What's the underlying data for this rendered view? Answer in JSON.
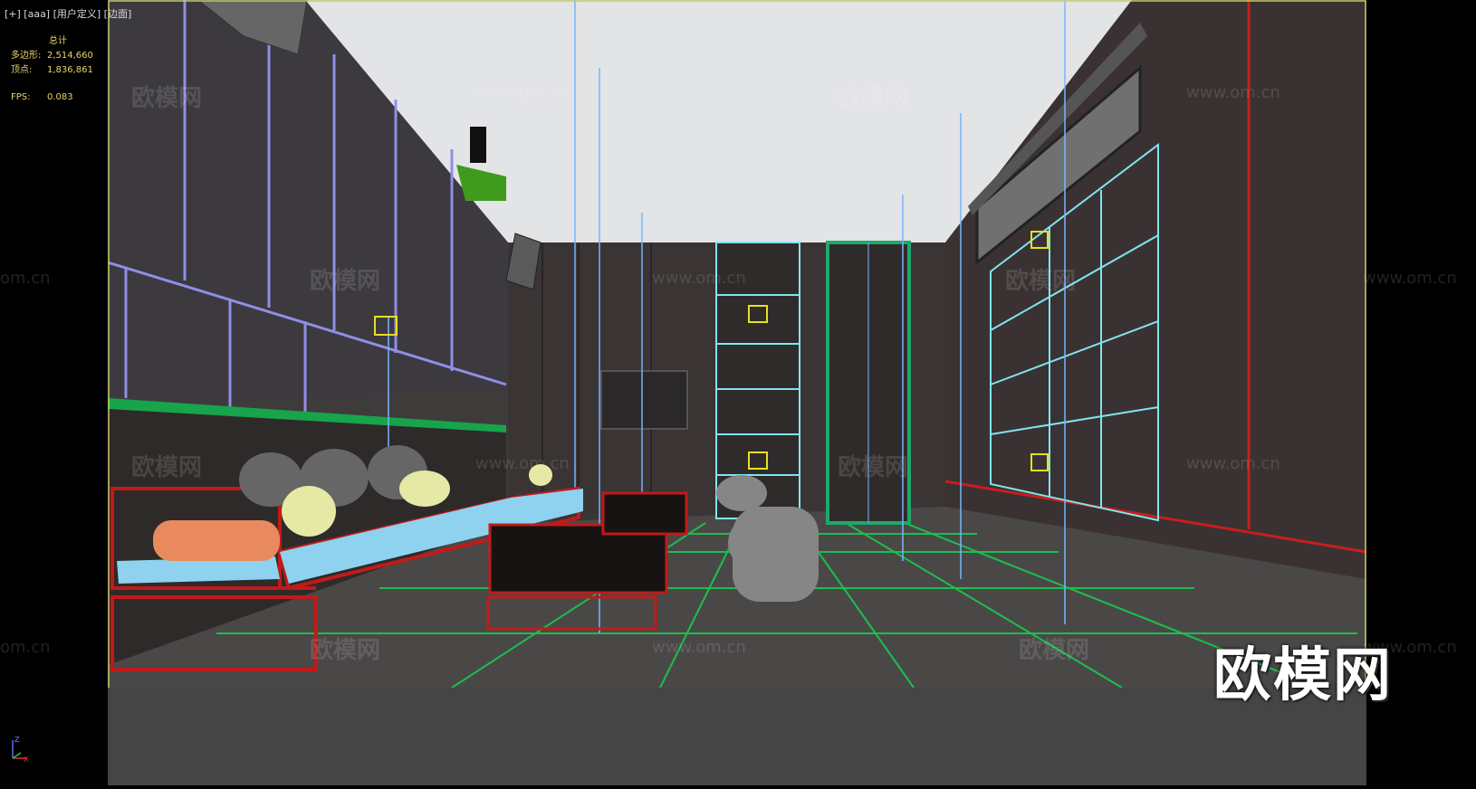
{
  "viewport": {
    "label": "[+] [aaa] [用户定义] [边面]"
  },
  "stats": {
    "title": "总计",
    "polys_label": "多边形:",
    "polys_value": "2,514,660",
    "verts_label": "顶点:",
    "verts_value": "1,836,861",
    "fps_label": "FPS:",
    "fps_value": "0.083"
  },
  "watermarks": {
    "cn": "欧模网",
    "url": "www.om.cn",
    "url_short": "om.cn"
  },
  "brand": "欧模网",
  "axis": {
    "z": "Z",
    "x": "X"
  },
  "colors": {
    "viewport_border": "#c8c86a",
    "ceiling": "#e3e4e6",
    "wall_dark": "#3a3535",
    "floor": "#4a4847",
    "sofa_frame": "#c11a1a",
    "cushion_blue": "#8fd2ef",
    "grid_green": "#1bbf4c",
    "wire_blue": "#74b8ff",
    "shelf_cyan": "#7fe5f0"
  }
}
